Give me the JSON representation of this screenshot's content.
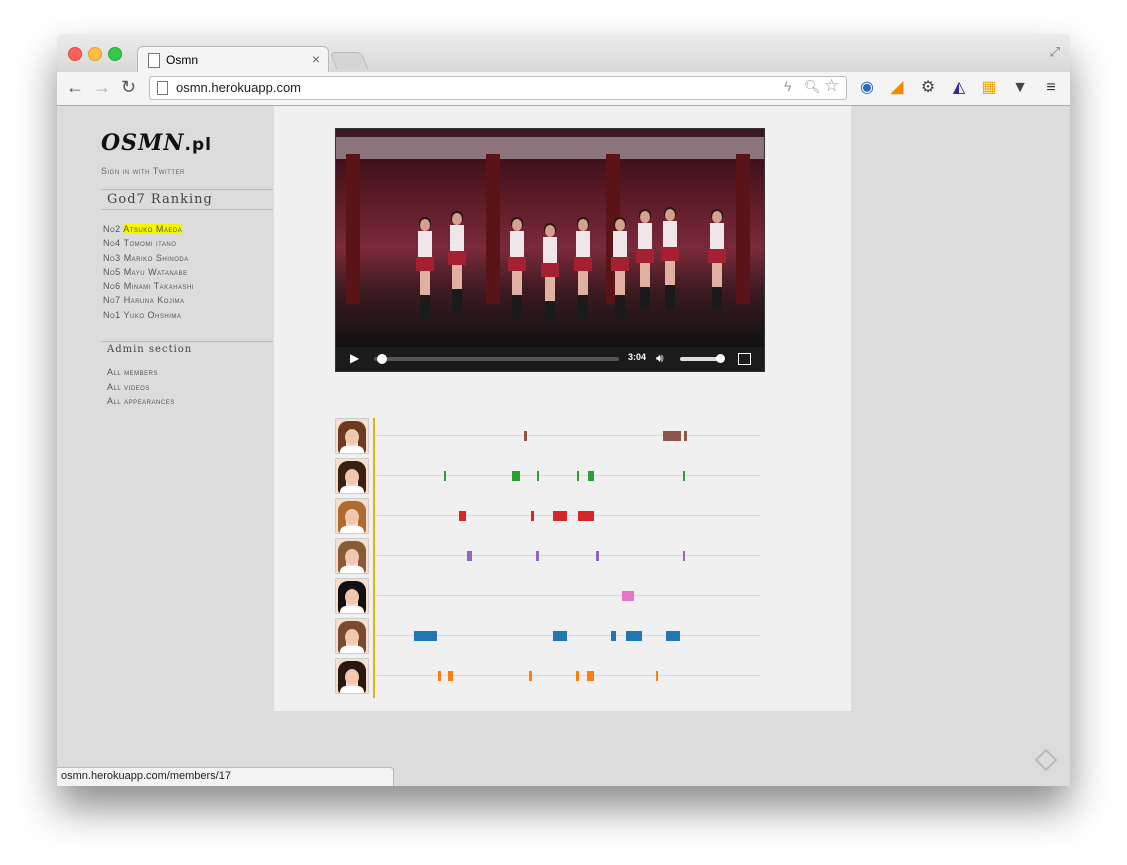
{
  "browser": {
    "tab_title": "Osmn",
    "tab_close": "×",
    "url": "osmn.herokuapp.com",
    "status_url": "osmn.herokuapp.com/members/17"
  },
  "sidebar": {
    "logo": "OSMN",
    "logo_tld": ".pl",
    "sign_in": "Sign in with Twitter",
    "ranking_title": "God7 Ranking",
    "ranking": [
      {
        "rank": "No2",
        "name": "Atsuko Maeda"
      },
      {
        "rank": "No4",
        "name": "Tomomi itano"
      },
      {
        "rank": "No3",
        "name": "Mariko Shinoda"
      },
      {
        "rank": "No5",
        "name": "Mayu Watanabe"
      },
      {
        "rank": "No6",
        "name": "Minami Takahashi"
      },
      {
        "rank": "No7",
        "name": "Haruna Kojima"
      },
      {
        "rank": "No1",
        "name": "Yuko Ohshima"
      }
    ],
    "admin_title": "Admin section",
    "admin_links": [
      "All members",
      "All videos",
      "All appearances"
    ]
  },
  "video": {
    "time": "3:04",
    "progress": 0.02,
    "volume": 0.9
  },
  "timeline": {
    "cursor_fraction": 0,
    "rows": [
      {
        "color": "#8c564b",
        "hair": "#6b3a20",
        "segments": [
          [
            0.388,
            0.007
          ],
          [
            0.748,
            0.046
          ],
          [
            0.802,
            0.009
          ]
        ]
      },
      {
        "color": "#2ca02c",
        "hair": "#3a2010",
        "segments": [
          [
            0.178,
            0.003
          ],
          [
            0.355,
            0.021
          ],
          [
            0.42,
            0.007
          ],
          [
            0.525,
            0.003
          ],
          [
            0.552,
            0.018
          ],
          [
            0.8,
            0.003
          ]
        ]
      },
      {
        "color": "#d62728",
        "hair": "#b06a30",
        "segments": [
          [
            0.218,
            0.019
          ],
          [
            0.405,
            0.008
          ],
          [
            0.463,
            0.036
          ],
          [
            0.527,
            0.041
          ]
        ]
      },
      {
        "color": "#9467bd",
        "hair": "#8a5a35",
        "segments": [
          [
            0.238,
            0.013
          ],
          [
            0.419,
            0.008
          ],
          [
            0.573,
            0.008
          ],
          [
            0.801,
            0.003
          ]
        ]
      },
      {
        "color": "#e377c2",
        "hair": "#151010",
        "segments": [
          [
            0.642,
            0.031
          ]
        ]
      },
      {
        "color": "#1f77b4",
        "hair": "#7a4a30",
        "segments": [
          [
            0.1,
            0.062
          ],
          [
            0.463,
            0.036
          ],
          [
            0.613,
            0.013
          ],
          [
            0.653,
            0.041
          ],
          [
            0.755,
            0.036
          ]
        ]
      },
      {
        "color": "#ff7f0e",
        "hair": "#2a1810",
        "segments": [
          [
            0.163,
            0.008
          ],
          [
            0.19,
            0.013
          ],
          [
            0.401,
            0.008
          ],
          [
            0.522,
            0.008
          ],
          [
            0.55,
            0.018
          ],
          [
            0.73,
            0.003
          ]
        ]
      }
    ]
  }
}
